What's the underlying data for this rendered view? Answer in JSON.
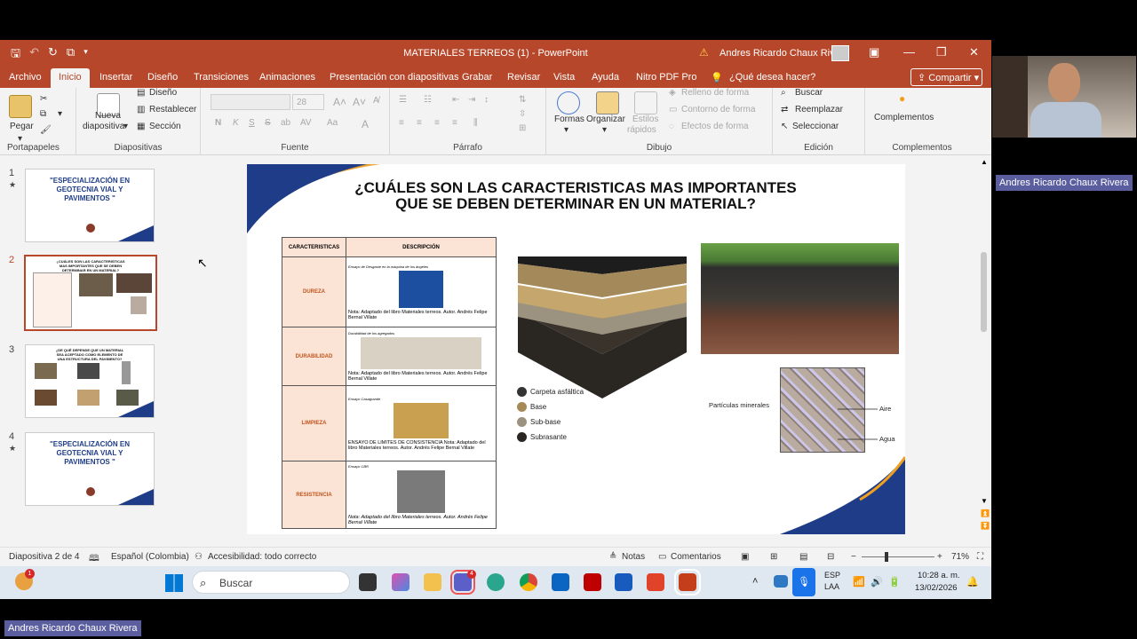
{
  "window": {
    "title": "MATERIALES TERREOS (1)  -  PowerPoint",
    "user": "Andres Ricardo Chaux Rivera"
  },
  "tabs": [
    "Archivo",
    "Inicio",
    "Insertar",
    "Diseño",
    "Transiciones",
    "Animaciones",
    "Presentación con diapositivas",
    "Grabar",
    "Revisar",
    "Vista",
    "Ayuda",
    "Nitro PDF Pro"
  ],
  "tell_me": "¿Qué desea hacer?",
  "share": "Compartir",
  "ribbon": {
    "portapapeles": {
      "label": "Portapapeles",
      "paste": "Pegar"
    },
    "diapositivas": {
      "label": "Diapositivas",
      "new": "Nueva",
      "new2": "diapositiva",
      "layout": "Diseño",
      "reset": "Restablecer",
      "section": "Sección"
    },
    "fuente": {
      "label": "Fuente",
      "size": "28"
    },
    "parrafo": {
      "label": "Párrafo"
    },
    "dibujo": {
      "label": "Dibujo",
      "shapes": "Formas",
      "arrange": "Organizar",
      "styles": "Estilos",
      "styles2": "rápidos",
      "fill": "Relleno de forma",
      "outline": "Contorno de forma",
      "effects": "Efectos de forma"
    },
    "edicion": {
      "label": "Edición",
      "find": "Buscar",
      "replace": "Reemplazar",
      "select": "Seleccionar"
    },
    "complementos": {
      "label": "Complementos",
      "btn": "Complementos"
    }
  },
  "thumbnails": [
    {
      "num": "1",
      "title": "\"ESPECIALIZACIÓN EN GEOTECNIA VIAL Y PAVIMENTOS \""
    },
    {
      "num": "2",
      "title": "¿CUÁLES SON LAS CARACTERISTICAS MAS IMPORTANTES QUE SE DEBEN DETERMINAR EN UN MATERIAL?"
    },
    {
      "num": "3",
      "title": "¿DE QUÉ DEPENDE QUE UN MATERIAL SEA ACEPTADO COMO ELEMENTO DE UNA ESTRUCTURA DEL PAVIMENTO?"
    },
    {
      "num": "4",
      "title": "\"ESPECIALIZACIÓN EN GEOTECNIA VIAL Y PAVIMENTOS \""
    }
  ],
  "slide": {
    "title": "¿CUÁLES SON LAS CARACTERISTICAS MAS IMPORTANTES QUE SE DEBEN DETERMINAR EN UN MATERIAL?",
    "table_headers": [
      "CARACTERISTICAS",
      "DESCRIPCIÓN"
    ],
    "rows": [
      {
        "name": "DUREZA",
        "caption": "Ensayo de Desgaste en la máquina de los ángeles",
        "note": "Nota: Adaptado del libro Materiales terreos. Autor. Andrés Felipe Bernal Villate"
      },
      {
        "name": "DURABILIDAD",
        "caption": "Durabilidad de los agregados",
        "note": "Nota: Adaptado del libro Materiales terreos. Autor. Andrés Felipe Bernal Villate"
      },
      {
        "name": "LIMPIEZA",
        "caption": "Ensayo Casagrande",
        "note": "ENSAYO DE LIMITES DE CONSISTENCIA Nota: Adaptado del libro Materiales terreos. Autor. Andrés Felipe Bernal Villate"
      },
      {
        "name": "RESISTENCIA",
        "caption": "Ensayo CBR",
        "note": "Nota: Adaptado del libro Materiales terreos. Autor. Andrés Felipe Bernal Villate"
      }
    ],
    "legend": [
      "Carpeta asfáltica",
      "Base",
      "Sub-base",
      "Subrasante"
    ],
    "particles": {
      "minerals": "Partículas minerales",
      "air": "Aire",
      "water": "Agua"
    }
  },
  "status": {
    "slide": "Diapositiva 2 de 4",
    "lang": "Español (Colombia)",
    "access": "Accesibilidad: todo correcto",
    "notes": "Notas",
    "comments": "Comentarios",
    "zoom": "71%"
  },
  "taskbar": {
    "search": "Buscar",
    "lang1": "ESP",
    "lang2": "LAA",
    "time": "10:28 a. m.",
    "date": "13/02/2026",
    "badge": "1",
    "teams_badge": "4"
  },
  "webcam": {
    "name": "Andres Ricardo Chaux Rivera"
  },
  "bottom_name": "Andres Ricardo Chaux Rivera"
}
